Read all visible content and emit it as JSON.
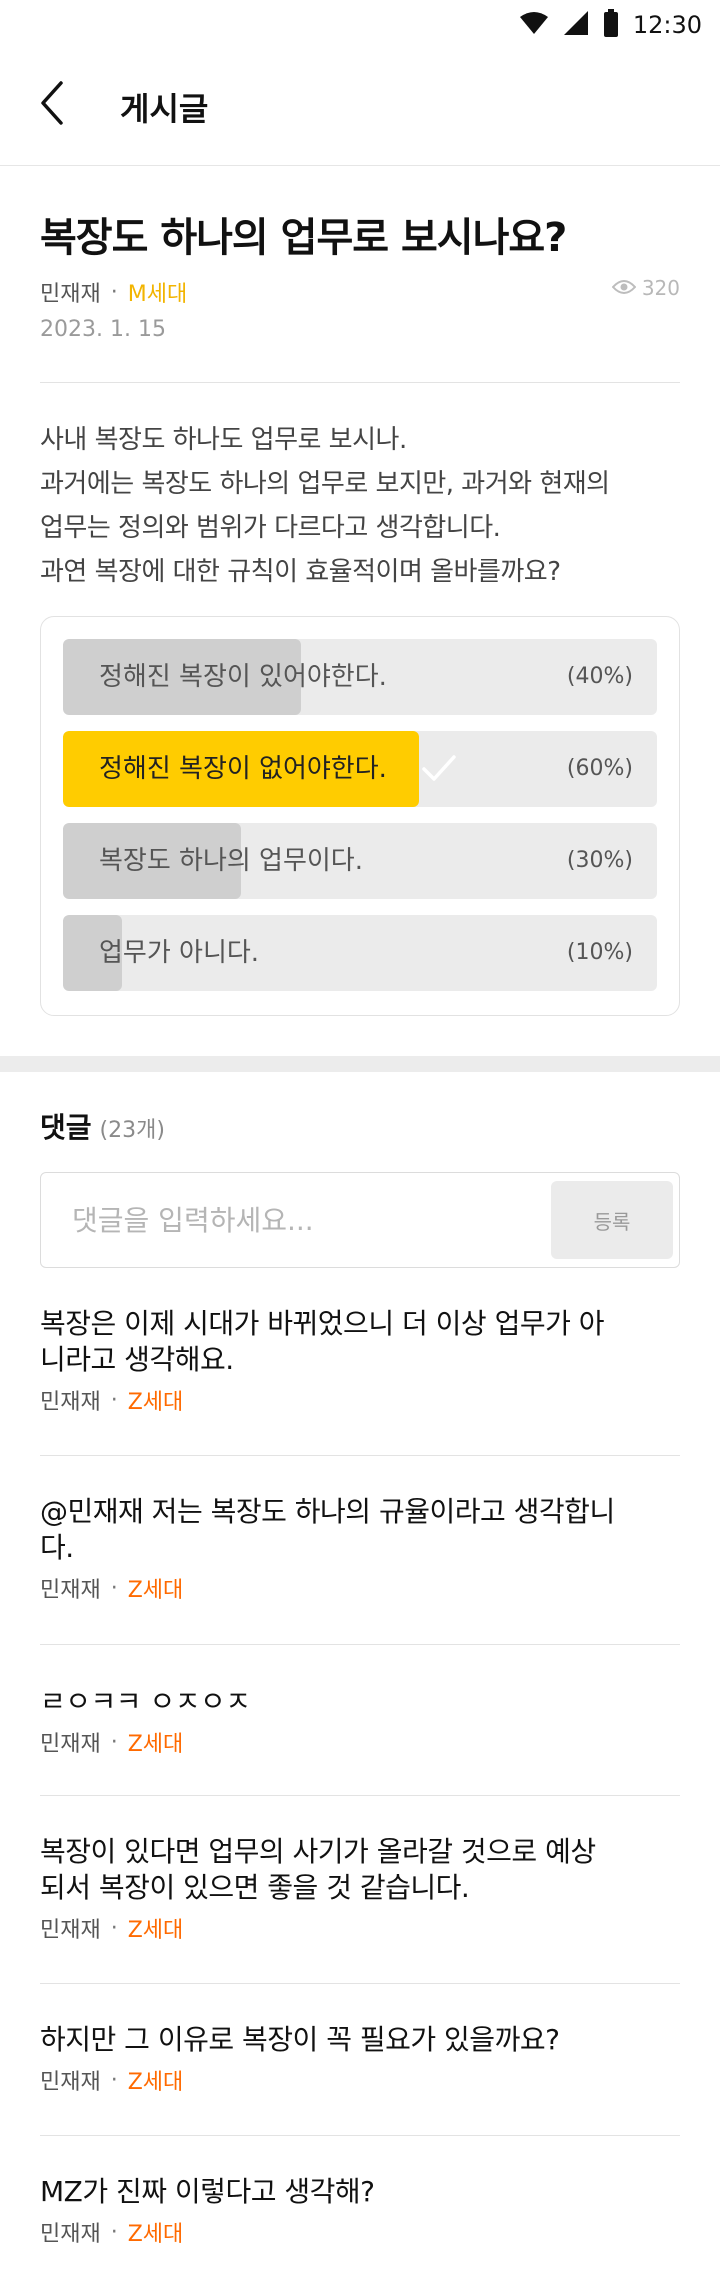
{
  "status": {
    "time": "12:30"
  },
  "header": {
    "title": "게시글"
  },
  "post": {
    "title": "복장도 하나의 업무로 보시나요?",
    "author": "민재재",
    "generation": "M세대",
    "views": "320",
    "date": "2023. 1. 15",
    "body": [
      "사내 복장도 하나도 업무로 보시나.",
      "과거에는 복장도 하나의 업무로 보지만,  과거와 현재의",
      "업무는 정의와 범위가 다르다고 생각합니다.",
      "과연 복장에 대한 규칙이 효율적이며 올바를까요?"
    ]
  },
  "poll": {
    "options": [
      {
        "label": "정해진 복장이 있어야한다.",
        "percent_text": "(40%)",
        "fill": 0.4,
        "selected": false
      },
      {
        "label": "정해진 복장이 없어야한다.",
        "percent_text": "(60%)",
        "fill": 0.6,
        "selected": true
      },
      {
        "label": "복장도 하나의 업무이다.",
        "percent_text": "(30%)",
        "fill": 0.3,
        "selected": false
      },
      {
        "label": "업무가 아니다.",
        "percent_text": "(10%)",
        "fill": 0.1,
        "selected": false
      }
    ]
  },
  "comments": {
    "title": "댓글",
    "count": "(23개)",
    "input_placeholder": "댓글을 입력하세요...",
    "submit_label": "등록",
    "items": [
      {
        "text": "복장은 이제 시대가 바뀌었으니 더 이상 업무가 아니라고 생각해요.",
        "author": "민재재",
        "generation": "Z세대"
      },
      {
        "text": "@민재재 저는 복장도 하나의 규율이라고 생각합니다.",
        "author": "민재재",
        "generation": "Z세대"
      },
      {
        "text": "ㄹㅇㅋㅋ ㅇㅈㅇㅈ",
        "author": "민재재",
        "generation": "Z세대"
      },
      {
        "text": "복장이 있다면 업무의 사기가 올라갈 것으로 예상되서 복장이 있으면 좋을 것 같습니다.",
        "author": "민재재",
        "generation": "Z세대"
      },
      {
        "text": "하지만 그 이유로 복장이 꼭 필요가 있을까요?",
        "author": "민재재",
        "generation": "Z세대"
      },
      {
        "text": "MZ가 진짜 이렇다고 생각해?",
        "author": "민재재",
        "generation": "Z세대"
      }
    ]
  },
  "colors": {
    "accent_yellow": "#ffcc00",
    "m_generation": "#f2b400",
    "z_generation": "#ff6a00"
  },
  "icons": [
    "wifi-icon",
    "signal-icon",
    "battery-icon",
    "back-arrow-icon",
    "eye-icon",
    "checkmark-icon"
  ]
}
